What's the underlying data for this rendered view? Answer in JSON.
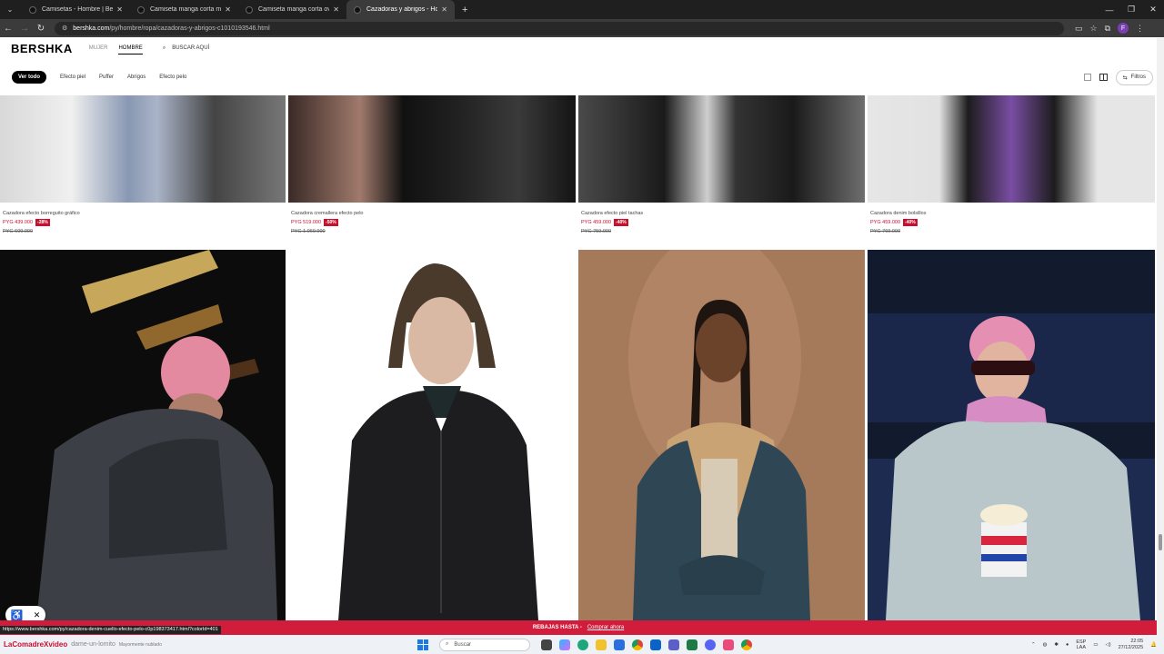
{
  "browser": {
    "tabs": [
      {
        "label": "Camisetas - Hombre | Bershka",
        "active": false
      },
      {
        "label": "Camiseta manga corta mesh - I",
        "active": false
      },
      {
        "label": "Camiseta manga corta oversiz",
        "active": false
      },
      {
        "label": "Cazadoras y abrigos - Hombr",
        "active": true
      }
    ],
    "new_tab": "+",
    "url_host": "bershka.com",
    "url_path": "/py/hombre/ropa/cazadoras-y-abrigos-c1010193546.html",
    "profile_initial": "F"
  },
  "site": {
    "logo": "BERSHKA",
    "nav": [
      "MUJER",
      "HOMBRE"
    ],
    "search_label": "BUSCAR AQUÍ",
    "chips": [
      "Ver todo",
      "Efecto piel",
      "Puffer",
      "Abrigos",
      "Efecto pelo"
    ],
    "filter_label": "Filtros"
  },
  "products_top": [
    {
      "name": "Cazadora efecto borreguito gráfico",
      "price": "PYG 439.000",
      "discount": "-28%",
      "old_price": "PYG 609.000"
    },
    {
      "name": "Cazadora cremallera efecto pelo",
      "price": "PYG 519.000",
      "discount": "-50%",
      "old_price": "PYG 1.069.000"
    },
    {
      "name": "Cazadora efecto piel tachas",
      "price": "PYG 459.000",
      "discount": "-40%",
      "old_price": "PYG 759.000"
    },
    {
      "name": "Cazadora denim bolsillos",
      "price": "PYG 459.000",
      "discount": "-40%",
      "old_price": "PYG 769.000"
    }
  ],
  "banner": {
    "text": "REBAJAS HASTA -",
    "link": "Comprar ahora"
  },
  "status_url": "https://www.bershka.com/py/cazadora-denim-cuello-efecto-pelo-c0p198373417.html?colorId=401",
  "taskbar": {
    "watermark": "LaComadreXvideo",
    "watermark2": "dame-un-lomito",
    "watermark_sub": "Mayormente nublado",
    "search_placeholder": "Buscar",
    "lang_top": "ESP",
    "lang_bottom": "LAA",
    "time": "22:05",
    "date": "27/12/2025"
  },
  "colors": {
    "accent": "#c8102e",
    "banner": "#d21c3c"
  }
}
